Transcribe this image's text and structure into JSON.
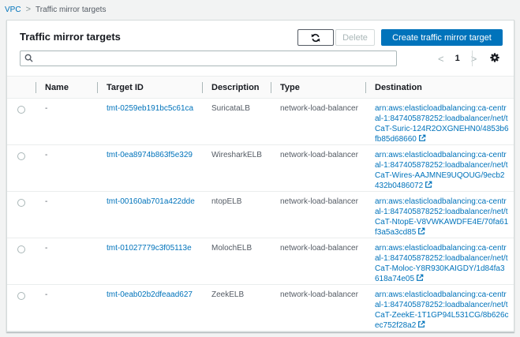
{
  "breadcrumb": {
    "root": "VPC",
    "separator": ">",
    "current": "Traffic mirror targets"
  },
  "header": {
    "title": "Traffic mirror targets"
  },
  "toolbar": {
    "refresh_icon": "refresh-icon",
    "delete_label": "Delete",
    "create_label": "Create traffic mirror target"
  },
  "search": {
    "value": "",
    "placeholder": ""
  },
  "pagination": {
    "prev": "<",
    "page": "1",
    "next": ">"
  },
  "table": {
    "columns": [
      "Name",
      "Target ID",
      "Description",
      "Type",
      "Destination"
    ],
    "rows": [
      {
        "name": "-",
        "target_id": "tmt-0259eb191bc5c61ca",
        "description": "SuricataLB",
        "type": "network-load-balancer",
        "destination": "arn:aws:elasticloadbalancing:ca-central-1:847405878252:loadbalancer/net/tCaT-Suric-124R2OXGNEHN0/4853b6fb85d68660"
      },
      {
        "name": "-",
        "target_id": "tmt-0ea8974b863f5e329",
        "description": "WiresharkELB",
        "type": "network-load-balancer",
        "destination": "arn:aws:elasticloadbalancing:ca-central-1:847405878252:loadbalancer/net/tCaT-Wires-AAJMNE9UQOUG/9ecb2432b0486072"
      },
      {
        "name": "-",
        "target_id": "tmt-00160ab701a422dde",
        "description": "ntopELB",
        "type": "network-load-balancer",
        "destination": "arn:aws:elasticloadbalancing:ca-central-1:847405878252:loadbalancer/net/tCaT-NtopE-V8VWKAWDFE4E/70fa61f3a5a3cd85"
      },
      {
        "name": "-",
        "target_id": "tmt-01027779c3f05113e",
        "description": "MolochELB",
        "type": "network-load-balancer",
        "destination": "arn:aws:elasticloadbalancing:ca-central-1:847405878252:loadbalancer/net/tCaT-Moloc-Y8R930KAIGDY/1d84fa3618a74e05"
      },
      {
        "name": "-",
        "target_id": "tmt-0eab02b2dfeaad627",
        "description": "ZeekELB",
        "type": "network-load-balancer",
        "destination": "arn:aws:elasticloadbalancing:ca-central-1:847405878252:loadbalancer/net/tCaT-ZeekE-1T1GP94L531CG/8b626cec752f28a2"
      }
    ]
  },
  "colors": {
    "link": "#0073bb",
    "primary_button": "#0073bb",
    "border": "#d5dbdb"
  }
}
